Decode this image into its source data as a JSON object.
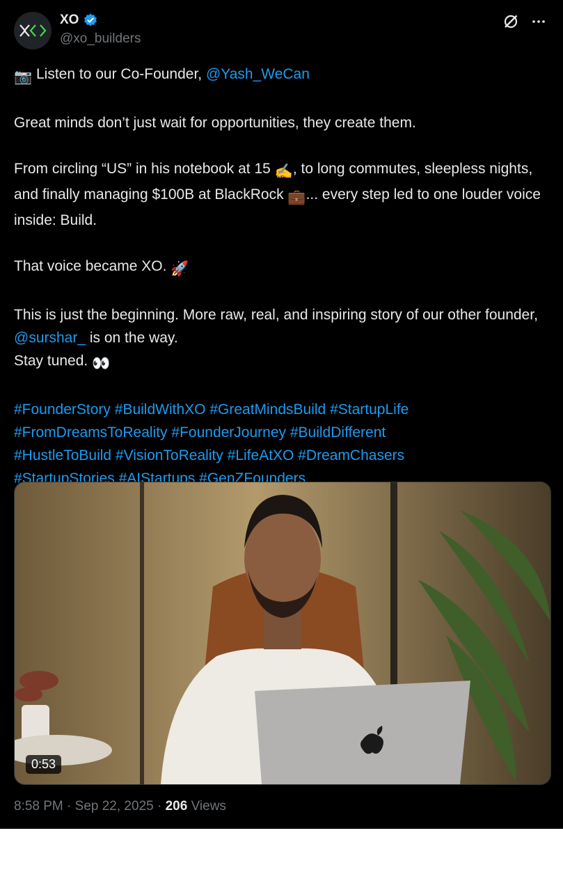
{
  "author": {
    "name": "XO",
    "handle": "@xo_builders",
    "verified": true,
    "verified_color": "#1d9bf0"
  },
  "icons": {
    "grok": "grok-icon",
    "more": "more-icon"
  },
  "tweet": {
    "line1_emoji": "📷",
    "line1_text": " Listen to our Co-Founder, ",
    "line1_mention": "@Yash_WeCan",
    "para2": "Great minds don’t just wait for opportunities, they create them.",
    "para3_a": "From circling “US” in his notebook at 15 ",
    "para3_emoji1": "✍️",
    "para3_b": ", to long commutes, sleepless nights, and finally managing $100B at BlackRock ",
    "para3_emoji2": "💼",
    "para3_c": "... every step led to one louder voice inside: Build.",
    "para4_text": "That voice became XO. ",
    "para4_emoji": "🚀",
    "para5_a": "This is just the beginning. More raw, real, and inspiring story of our other founder, ",
    "para5_mention": "@surshar_",
    "para5_b": "  is on the way.",
    "para6_text": "Stay tuned. ",
    "para6_emoji": "👀",
    "hashtags": [
      "#FounderStory",
      "#BuildWithXO",
      "#GreatMindsBuild",
      "#StartupLife",
      "#FromDreamsToReality",
      "#FounderJourney",
      "#BuildDifferent",
      "#HustleToBuild",
      "#VisionToReality",
      "#LifeAtXO",
      "#DreamChasers",
      "#StartupStories",
      "#AIStartups",
      "#GenZFounders"
    ]
  },
  "media": {
    "duration": "0:53"
  },
  "meta": {
    "time": "8:58 PM",
    "date": "Sep 22, 2025",
    "views_count": "206",
    "views_label": "Views"
  },
  "colors": {
    "background": "#000000",
    "text": "#e7e9ea",
    "secondary": "#71767b",
    "link": "#1d9bf0",
    "logo_green": "#3ddc4a"
  }
}
